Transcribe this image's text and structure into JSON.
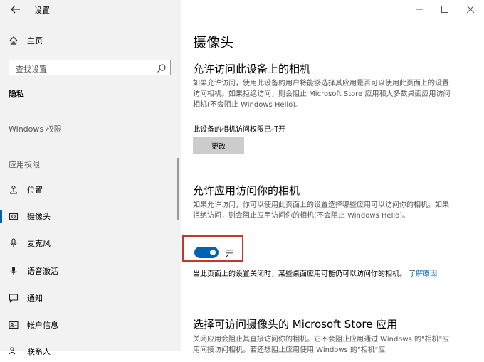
{
  "app": {
    "title": "设置",
    "window_controls": {
      "minimize": "—",
      "maximize": "☐",
      "close": "✕"
    }
  },
  "sidebar": {
    "home_label": "主页",
    "search_placeholder": "查找设置",
    "section_privacy": "隐私",
    "group_windows": "Windows 权限",
    "group_app": "应用权限",
    "items": [
      {
        "label": "位置",
        "icon": "location-icon"
      },
      {
        "label": "摄像头",
        "icon": "camera-icon",
        "selected": true
      },
      {
        "label": "麦克风",
        "icon": "microphone-icon"
      },
      {
        "label": "语音激活",
        "icon": "voice-activation-icon"
      },
      {
        "label": "通知",
        "icon": "notification-icon"
      },
      {
        "label": "帐户信息",
        "icon": "account-info-icon"
      },
      {
        "label": "联系人",
        "icon": "contacts-icon"
      }
    ]
  },
  "main": {
    "page_title": "摄像头",
    "section1": {
      "heading": "允许访问此设备上的相机",
      "desc": "如果允许访问，使用此设备的用户将能够选择其应用是否可以使用此页面上的设置访问相机。如果拒绝访问，则会阻止 Microsoft Store 应用和大多数桌面应用访问相机(不会阻止 Windows Hello)。",
      "status": "此设备的相机访问权限已打开",
      "change_button": "更改"
    },
    "section2": {
      "heading": "允许应用访问你的相机",
      "desc": "如果允许访问，你可以使用此页面上的设置选择哪些应用可以访问你的相机。如果拒绝访问，则会阻止应用访问你的相机(不会阻止 Windows Hello)。",
      "toggle_state": "开",
      "note": "当此页面上的设置关闭时，某些桌面应用可能仍可以访问你的相机。",
      "learn_more": "了解原因"
    },
    "section3": {
      "heading": "选择可访问摄像头的 Microsoft Store 应用",
      "desc": "关闭应用会阻止其直接访问你的相机。它不会阻止应用通过 Windows 的\"相机\"应用间接访问相机。若还想阻止应用使用 Windows 的\"相机\"应"
    }
  },
  "colors": {
    "accent": "#0063b1",
    "highlight": "#c0392b",
    "sidebar_bg": "#f2f2f2"
  }
}
